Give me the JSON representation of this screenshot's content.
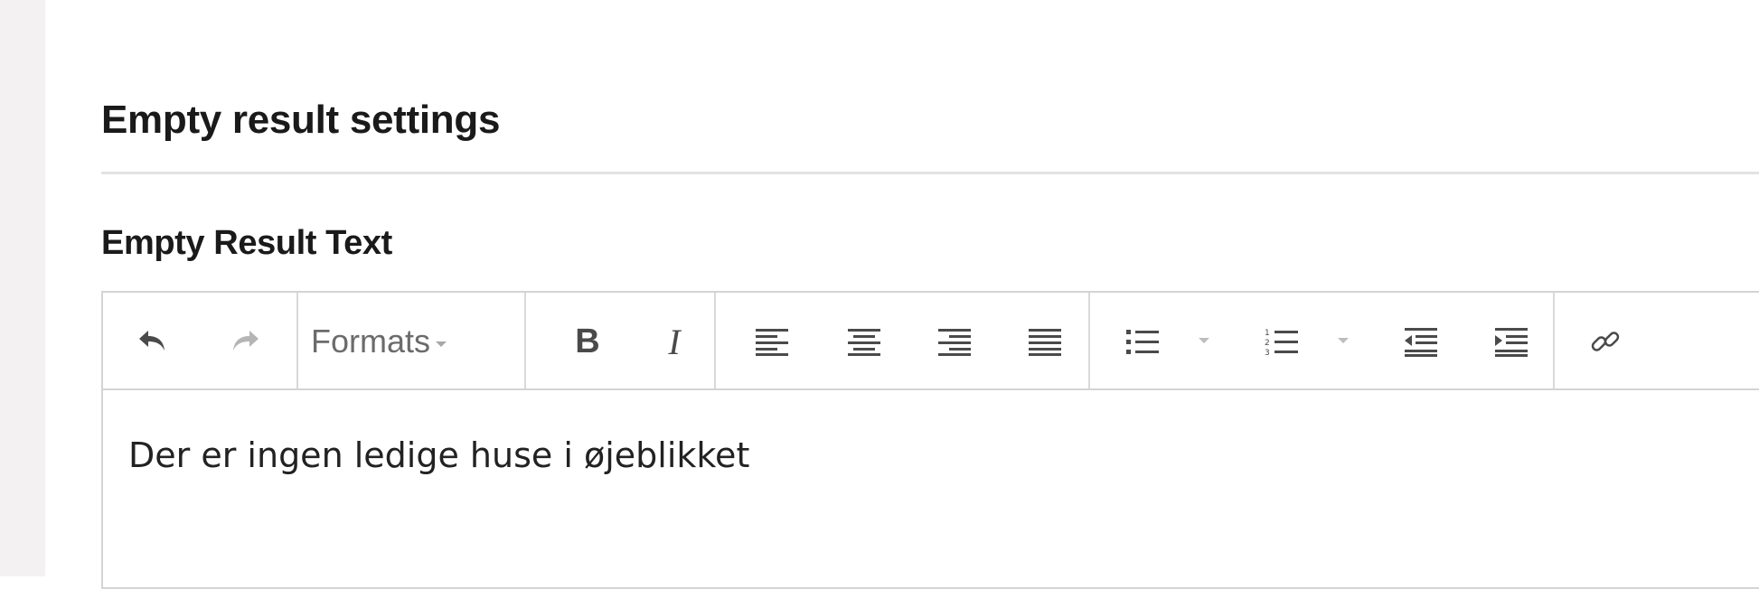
{
  "section": {
    "title": "Empty result settings"
  },
  "field": {
    "label": "Empty Result Text"
  },
  "toolbar": {
    "formats_label": "Formats",
    "buttons": [
      {
        "name": "undo-button",
        "icon": "undo-icon"
      },
      {
        "name": "redo-button",
        "icon": "redo-icon"
      },
      {
        "name": "bold-button",
        "icon": "bold-icon"
      },
      {
        "name": "italic-button",
        "icon": "italic-icon"
      },
      {
        "name": "align-left-button",
        "icon": "align-left-icon"
      },
      {
        "name": "align-center-button",
        "icon": "align-center-icon"
      },
      {
        "name": "align-right-button",
        "icon": "align-right-icon"
      },
      {
        "name": "align-justify-button",
        "icon": "align-justify-icon"
      },
      {
        "name": "bullet-list-button",
        "icon": "bullet-list-icon"
      },
      {
        "name": "numbered-list-button",
        "icon": "numbered-list-icon"
      },
      {
        "name": "outdent-button",
        "icon": "outdent-icon"
      },
      {
        "name": "indent-button",
        "icon": "indent-icon"
      },
      {
        "name": "link-button",
        "icon": "link-icon"
      }
    ]
  },
  "editor": {
    "content": "Der er ingen ledige huse i øjeblikket"
  },
  "colors": {
    "icon": "#4a4a4a",
    "icon_disabled": "#b5b5b5",
    "border": "#d4d4d4",
    "sidebar_bg": "#f3f1f2"
  }
}
